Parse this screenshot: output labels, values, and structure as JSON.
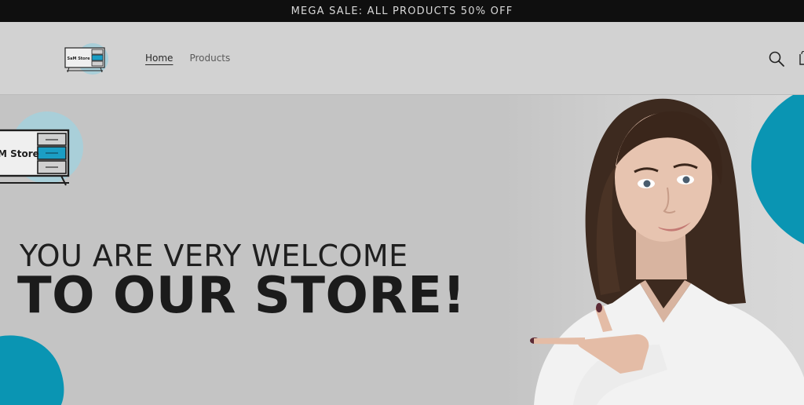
{
  "announcement": {
    "text": "MEGA SALE: ALL PRODUCTS 50% OFF"
  },
  "header": {
    "logo_text": "SaM Store",
    "nav": [
      {
        "label": "Home",
        "active": true
      },
      {
        "label": "Products",
        "active": false
      }
    ],
    "icons": [
      "search-icon",
      "cart-icon"
    ]
  },
  "hero": {
    "logo_text": "SaM Store",
    "line1": "YOU ARE VERY WELCOME",
    "line2": "TO OUR STORE!",
    "accent_color": "#0099b8",
    "image": "woman-pointing"
  }
}
